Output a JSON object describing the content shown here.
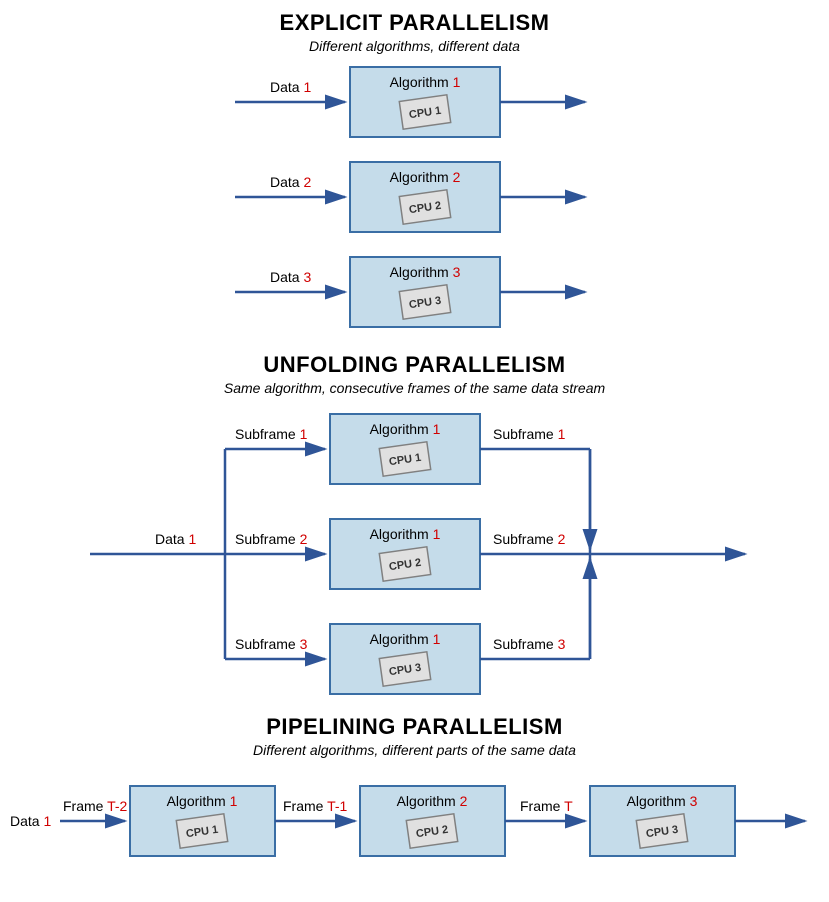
{
  "sections": {
    "explicit": {
      "title": "EXPLICIT PARALLELISM",
      "subtitle": "Different algorithms, different data",
      "rows": [
        {
          "data_label": "Data ",
          "data_num": "1",
          "algo_label": "Algorithm ",
          "algo_num": "1",
          "cpu": "CPU 1"
        },
        {
          "data_label": "Data ",
          "data_num": "2",
          "algo_label": "Algorithm ",
          "algo_num": "2",
          "cpu": "CPU 2"
        },
        {
          "data_label": "Data ",
          "data_num": "3",
          "algo_label": "Algorithm ",
          "algo_num": "3",
          "cpu": "CPU 3"
        }
      ]
    },
    "unfolding": {
      "title": "UNFOLDING PARALLELISM",
      "subtitle": "Same algorithm, consecutive frames of the same data stream",
      "data_label": "Data ",
      "data_num": "1",
      "rows": [
        {
          "in_label": "Subframe ",
          "in_num": "1",
          "algo_label": "Algorithm ",
          "algo_num": "1",
          "cpu": "CPU 1",
          "out_label": "Subframe ",
          "out_num": "1"
        },
        {
          "in_label": "Subframe ",
          "in_num": "2",
          "algo_label": "Algorithm ",
          "algo_num": "1",
          "cpu": "CPU 2",
          "out_label": "Subframe ",
          "out_num": "2"
        },
        {
          "in_label": "Subframe ",
          "in_num": "3",
          "algo_label": "Algorithm ",
          "algo_num": "1",
          "cpu": "CPU 3",
          "out_label": "Subframe ",
          "out_num": "3"
        }
      ]
    },
    "pipelining": {
      "title": "PIPELINING PARALLELISM",
      "subtitle": "Different algorithms, different parts of the same data",
      "data_label": "Data ",
      "data_num": "1",
      "frames": [
        {
          "label": "Frame ",
          "num": "T-2"
        },
        {
          "label": "Frame ",
          "num": "T-1"
        },
        {
          "label": "Frame ",
          "num": "T"
        }
      ],
      "stages": [
        {
          "algo_label": "Algorithm ",
          "algo_num": "1",
          "cpu": "CPU 1"
        },
        {
          "algo_label": "Algorithm ",
          "algo_num": "2",
          "cpu": "CPU 2"
        },
        {
          "algo_label": "Algorithm ",
          "algo_num": "3",
          "cpu": "CPU 3"
        }
      ]
    }
  }
}
